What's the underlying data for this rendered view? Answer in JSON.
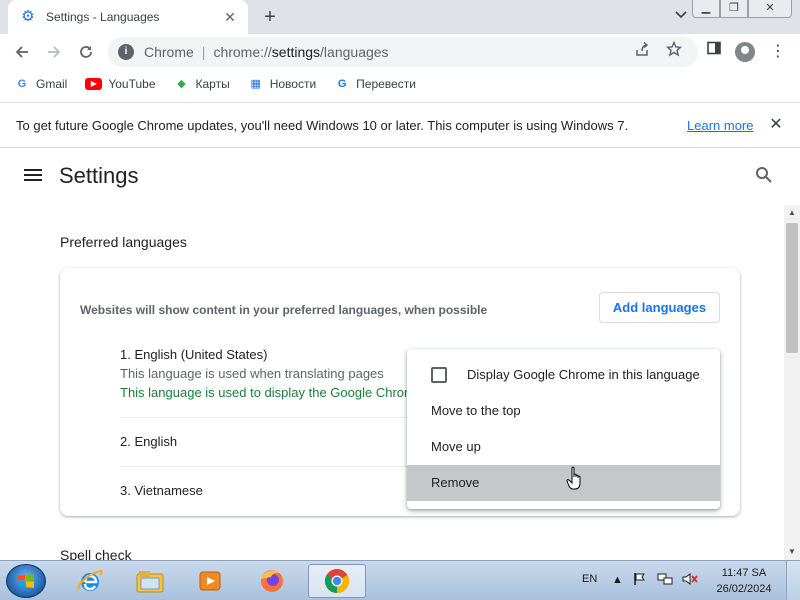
{
  "browser": {
    "tab": {
      "title": "Settings - Languages",
      "favicon": "gear-icon"
    },
    "omnibox": {
      "origin": "Chrome",
      "separator": "|",
      "url_prefix": "chrome://",
      "url_host": "settings",
      "url_path": "/languages"
    },
    "bookmarks": [
      {
        "label": "Gmail",
        "icon": "google-icon",
        "glyph": "G"
      },
      {
        "label": "YouTube",
        "icon": "youtube-icon",
        "glyph": "▶"
      },
      {
        "label": "Карты",
        "icon": "maps-icon",
        "glyph": "◆"
      },
      {
        "label": "Новости",
        "icon": "news-icon",
        "glyph": "▦"
      },
      {
        "label": "Перевести",
        "icon": "translate-icon",
        "glyph": "G"
      }
    ]
  },
  "infobar": {
    "message": "To get future Google Chrome updates, you'll need Windows 10 or later. This computer is using Windows 7.",
    "learn_more": "Learn more"
  },
  "settings": {
    "title": "Settings",
    "section_title": "Preferred languages",
    "card": {
      "description": "Websites will show content in your preferred languages, when possible",
      "add_button": "Add languages",
      "languages": [
        {
          "name": "1. English (United States)",
          "sub1": "This language is used when translating pages",
          "sub2": "This language is used to display the Google Chrome UI"
        },
        {
          "name": "2. English"
        },
        {
          "name": "3. Vietnamese"
        }
      ]
    },
    "next_section": "Spell check"
  },
  "context_menu": {
    "items": [
      {
        "label": "Display Google Chrome in this language",
        "checkbox": true,
        "checked": false
      },
      {
        "label": "Move to the top"
      },
      {
        "label": "Move up"
      },
      {
        "label": "Remove",
        "highlighted": true
      }
    ]
  },
  "taskbar": {
    "language": "EN",
    "time": "11:47 SA",
    "date": "26/02/2024"
  }
}
